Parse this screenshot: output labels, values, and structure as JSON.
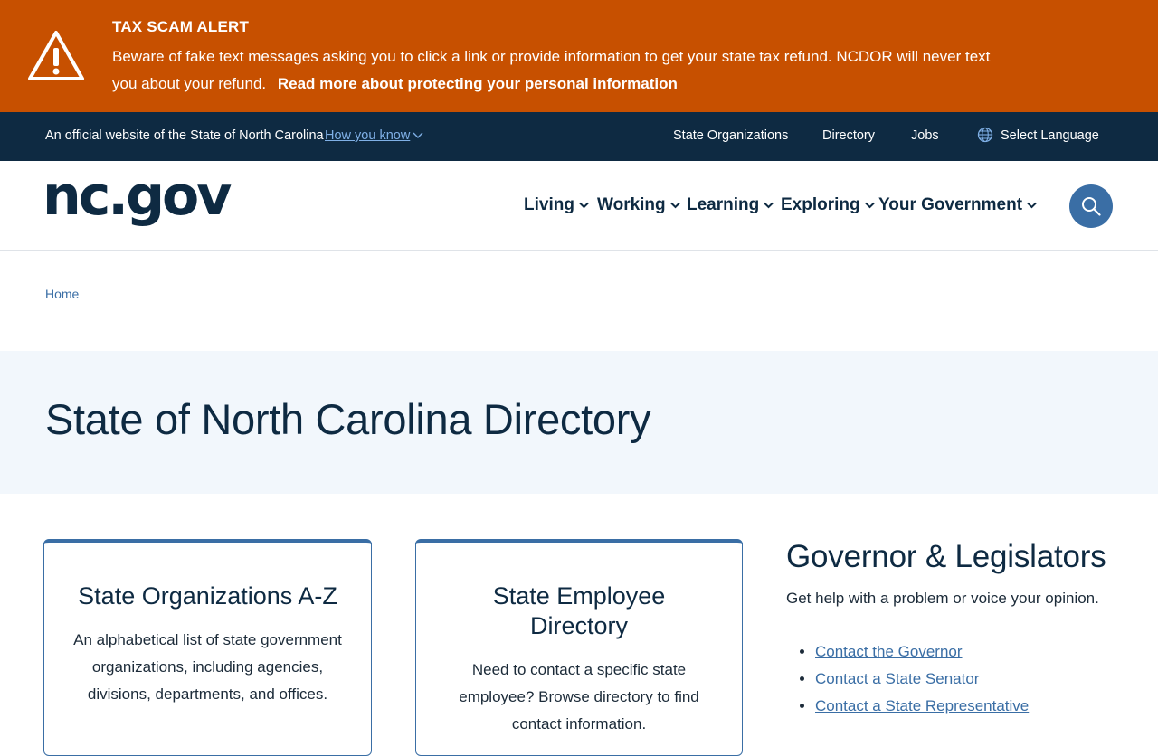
{
  "alert": {
    "title": "TAX SCAM ALERT",
    "body": "Beware of fake text messages asking you to click a link or provide information to get your state tax refund. NCDOR will never text you about your refund.",
    "link": "Read more about protecting your personal information",
    "icon": "warning-triangle-icon",
    "color": "#c75000"
  },
  "official_bar": {
    "text": "An official website of the State of North Carolina",
    "how_you_know": "How you know",
    "links": [
      "State Organizations",
      "Directory",
      "Jobs"
    ],
    "language": "Select Language",
    "color": "#0e2a42"
  },
  "header": {
    "logo": "nc.gov",
    "nav": [
      "Living",
      "Working",
      "Learning",
      "Exploring",
      "Your Government"
    ],
    "search_icon": "search-icon"
  },
  "breadcrumb": {
    "home": "Home"
  },
  "hero": {
    "title": "State of North Carolina Directory"
  },
  "cards": [
    {
      "title": "State Organizations A-Z",
      "description": "An alphabetical list of state government organizations, including agencies, divisions, departments, and offices."
    },
    {
      "title": "State Employee Directory",
      "description": "Need to contact a specific state employee? Browse directory to find contact information."
    }
  ],
  "governor": {
    "title": "Governor & Legislators",
    "subtitle": "Get help with a problem or voice your opinion.",
    "links": [
      "Contact the Governor",
      "Contact a State Senator",
      "Contact a State Representative"
    ]
  },
  "accent_color": "#3a6ea5"
}
